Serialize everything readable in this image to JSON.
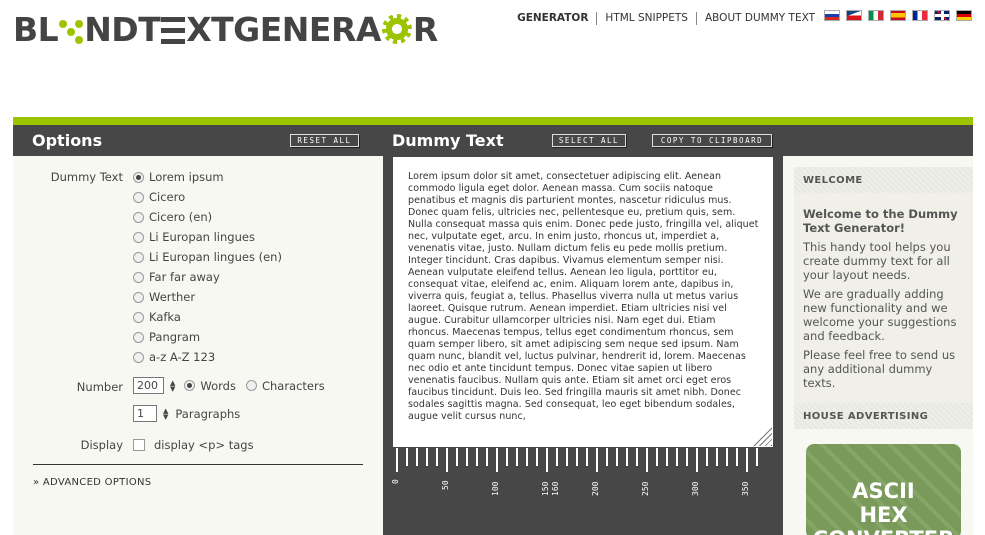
{
  "logo": {
    "part1": "BL",
    "part2": "NDT",
    "part3": "XTGENERA",
    "part4": "R"
  },
  "nav": {
    "items": [
      "GENERATOR",
      "HTML SNIPPETS",
      "ABOUT DUMMY TEXT"
    ],
    "languages": [
      "ru",
      "cz",
      "it",
      "es",
      "fr",
      "gb",
      "de"
    ]
  },
  "toolbar": {
    "options_title": "Options",
    "reset_label": "RESET ALL",
    "dummy_title": "Dummy Text",
    "select_label": "SELECT ALL",
    "copy_label": "COPY TO CLIPBOARD"
  },
  "options": {
    "dummy_label": "Dummy Text",
    "texts": [
      "Lorem ipsum",
      "Cicero",
      "Cicero (en)",
      "Li Europan lingues",
      "Li Europan lingues (en)",
      "Far far away",
      "Werther",
      "Kafka",
      "Pangram",
      "a-z A-Z 123"
    ],
    "selected_text": "Lorem ipsum",
    "number_label": "Number",
    "number_value": "200",
    "words_label": "Words",
    "characters_label": "Characters",
    "paragraphs_value": "1",
    "paragraphs_label": "Paragraphs",
    "display_label": "Display",
    "display_option": "display <p> tags",
    "advanced": "» ADVANCED OPTIONS"
  },
  "dummy_text": "Lorem ipsum dolor sit amet, consectetuer adipiscing elit. Aenean commodo ligula eget dolor. Aenean massa. Cum sociis natoque penatibus et magnis dis parturient montes, nascetur ridiculus mus. Donec quam felis, ultricies nec, pellentesque eu, pretium quis, sem. Nulla consequat massa quis enim. Donec pede justo, fringilla vel, aliquet nec, vulputate eget, arcu. In enim justo, rhoncus ut, imperdiet a, venenatis vitae, justo. Nullam dictum felis eu pede mollis pretium. Integer tincidunt. Cras dapibus. Vivamus elementum semper nisi. Aenean vulputate eleifend tellus. Aenean leo ligula, porttitor eu, consequat vitae, eleifend ac, enim. Aliquam lorem ante, dapibus in, viverra quis, feugiat a, tellus. Phasellus viverra nulla ut metus varius laoreet. Quisque rutrum. Aenean imperdiet. Etiam ultricies nisi vel augue. Curabitur ullamcorper ultricies nisi. Nam eget dui. Etiam rhoncus. Maecenas tempus, tellus eget condimentum rhoncus, sem quam semper libero, sit amet adipiscing sem neque sed ipsum. Nam quam nunc, blandit vel, luctus pulvinar, hendrerit id, lorem. Maecenas nec odio et ante tincidunt tempus. Donec vitae sapien ut libero venenatis faucibus. Nullam quis ante. Etiam sit amet orci eget eros faucibus tincidunt. Duis leo. Sed fringilla mauris sit amet nibh. Donec sodales sagittis magna. Sed consequat, leo eget bibendum sodales, augue velit cursus nunc,",
  "ruler": {
    "labels": [
      "0",
      "50",
      "100",
      "150",
      "160",
      "200",
      "250",
      "300",
      "350"
    ]
  },
  "sidebar": {
    "welcome_head": "WELCOME",
    "welcome_title": "Welcome to the Dummy Text Generator!",
    "p1": "This handy tool helps you create dummy text for all your layout needs.",
    "p2": "We are gradually adding new functionality and we welcome your suggestions and feedback.",
    "p3": "Please feel free to send us any additional dummy texts.",
    "ad_head": "HOUSE ADVERTISING",
    "ad_line1": "ASCII",
    "ad_line2": "HEX",
    "ad_line3": "CONVERTER"
  },
  "colors": {
    "accent": "#9cc400",
    "dark": "#474747"
  }
}
